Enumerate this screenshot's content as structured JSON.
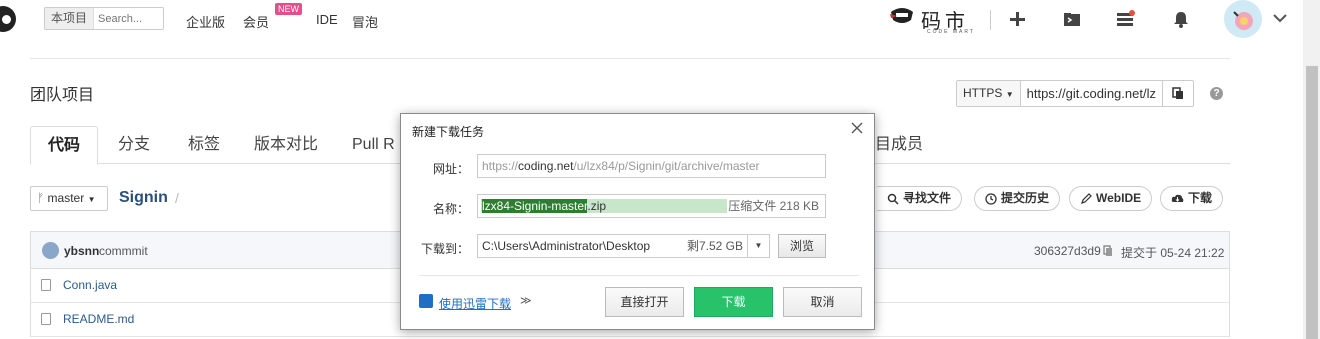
{
  "topnav": {
    "search_scope": "本项目",
    "search_placeholder": "Search...",
    "links": [
      "企业版",
      "会员",
      "IDE",
      "冒泡"
    ],
    "new_badge": "NEW",
    "brand_text": "码市",
    "brand_sub": "CODE MART"
  },
  "page": {
    "title": "团队项目",
    "clone": {
      "protocol": "HTTPS",
      "url": "https://git.coding.net/lz"
    },
    "tabs": [
      "代码",
      "分支",
      "标签",
      "版本对比",
      "Pull R",
      "目成员"
    ],
    "branch": "master",
    "repo_name": "Signin",
    "repo_slash": "/",
    "actions": [
      "寻找文件",
      "提交历史",
      "WebIDE",
      "下载"
    ],
    "commit": {
      "user": "ybsnn",
      "message": "commmit",
      "hash": "306327d3d9",
      "time": "提交于 05-24 21:22"
    },
    "files": [
      "Conn.java",
      "README.md"
    ]
  },
  "dialog": {
    "title": "新建下载任务",
    "url_label": "网址：",
    "url_prefix": "https://",
    "url_host": "coding.net",
    "url_path": "/u/lzx84/p/Signin/git/archive/master",
    "name_label": "名称：",
    "name_base": "lzx84-Signin-master",
    "name_ext": ".zip",
    "name_meta": "压缩文件 218 KB",
    "save_label": "下载到：",
    "save_path": "C:\\Users\\Administrator\\Desktop",
    "free_space": "剩7.52 GB",
    "browse": "浏览",
    "xunlei_link": "使用迅雷下载",
    "xunlei_chevron": "≫",
    "open_direct": "直接打开",
    "download": "下载",
    "cancel": "取消"
  }
}
